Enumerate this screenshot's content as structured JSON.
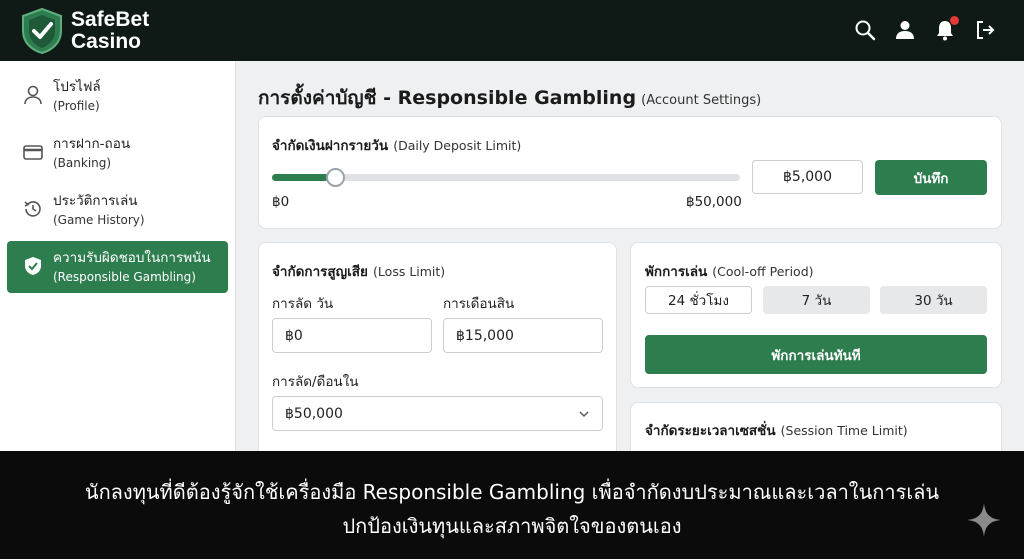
{
  "header": {
    "brand_line1": "SafeBet",
    "brand_line2": "Casino",
    "icons": [
      "search-icon",
      "user-icon",
      "bell-icon",
      "logout-icon"
    ],
    "notification_dot": true
  },
  "sidebar": {
    "items": [
      {
        "label_th": "โปรไฟล์",
        "label_en": "(Profile)",
        "icon": "user-icon",
        "active": false
      },
      {
        "label_th": "การฝาก-ถอน",
        "label_en": "(Banking)",
        "icon": "credit-card-icon",
        "active": false
      },
      {
        "label_th": "ประวัติการเล่น",
        "label_en": "(Game History)",
        "icon": "history-icon",
        "active": false
      },
      {
        "label_th": "ความรับผิดชอบในการพนัน",
        "label_en": "(Responsible Gambling)",
        "icon": "shield-check-icon",
        "active": true
      }
    ]
  },
  "main": {
    "title": "การตั้งค่าบัญชี - Responsible Gambling",
    "title_en": "(Account Settings)",
    "deposit_limit": {
      "title_th": "จำกัดเงินฝากรายวัน",
      "title_en": "(Daily Deposit Limit)",
      "slider_level": 0.135,
      "min_label": "฿0",
      "max_label": "฿50,000",
      "value": "฿5,000",
      "save_label": "บันทึก"
    },
    "loss_limit": {
      "title_th": "จำกัดการสูญเสีย",
      "title_en": "(Loss Limit)",
      "daily_label": "การลัด วัน",
      "daily_value": "฿0",
      "monthly_label": "การเดือนสิน",
      "monthly_value": "฿15,000",
      "period_label": "การลัด/ดือนใน",
      "period_value": "฿50,000"
    },
    "cool_off": {
      "title_th": "พักการเล่น",
      "title_en": "(Cool-off Period)",
      "options": [
        "24 ชั่วโมง",
        "7 วัน",
        "30 วัน"
      ],
      "selected": 0,
      "action_label": "พักการเล่นทันที"
    },
    "session_limit": {
      "title_th": "จำกัดระยะเวลาเซสชั่น",
      "title_en": "(Session Time Limit)"
    }
  },
  "caption": {
    "line1": "นักลงทุนที่ดีต้องรู้จักใช้เครื่องมือ Responsible Gambling เพื่อจำกัดงบประมาณและเวลาในการเล่น",
    "line2": "ปกป้องเงินทุนและสภาพจิตใจของตนเอง"
  },
  "colors": {
    "header_bg": "#0f1a16",
    "accent": "#2e7d4f",
    "notification": "#e53935"
  }
}
